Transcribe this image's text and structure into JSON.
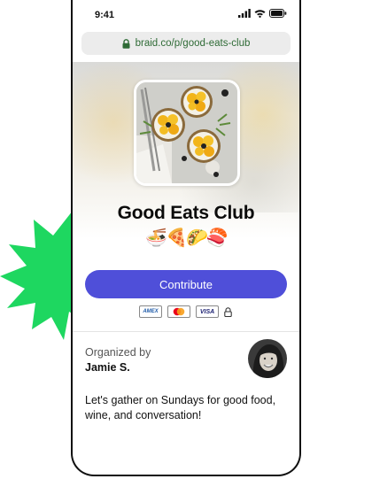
{
  "status_bar": {
    "time": "9:41"
  },
  "browser": {
    "url": "braid.co/p/good-eats-club"
  },
  "club": {
    "title": "Good Eats Club",
    "emojis": "🍜🍕🌮🍣"
  },
  "contribute_button": {
    "label": "Contribute"
  },
  "payment_methods": [
    {
      "name": "AMEX",
      "label": "AMEX"
    },
    {
      "name": "Mastercard",
      "label": ""
    },
    {
      "name": "VISA",
      "label": "VISA"
    }
  ],
  "organizer": {
    "label": "Organized by",
    "name": "Jamie S."
  },
  "description": "Let's gather on Sundays for good food, wine, and conversation!",
  "colors": {
    "accent": "#4f4fd9",
    "starburst": "#1ed760",
    "url_text": "#2f6b36"
  },
  "icons": [
    "signal-icon",
    "wifi-icon",
    "battery-icon",
    "lock-icon",
    "starburst-shape"
  ]
}
